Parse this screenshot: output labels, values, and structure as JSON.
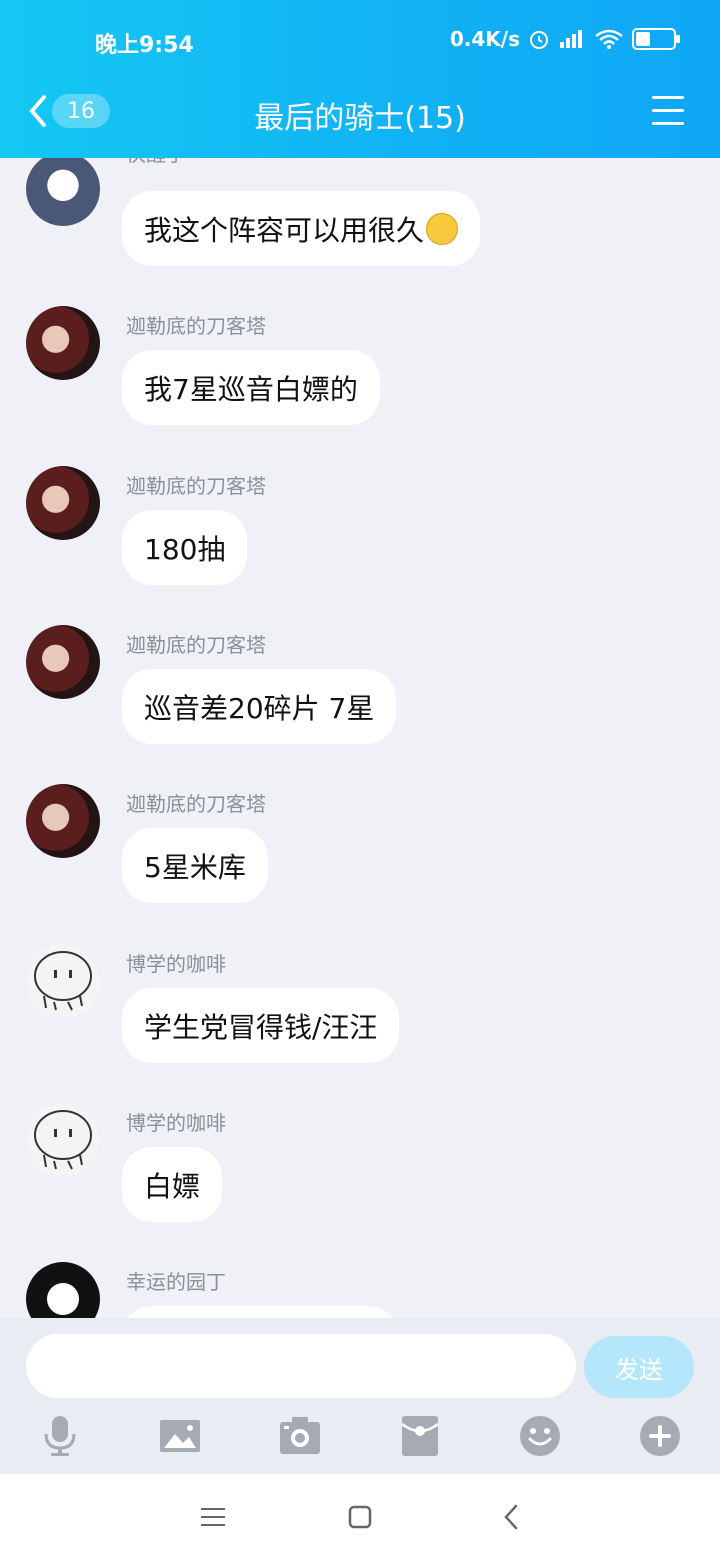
{
  "status_bar": {
    "time": "晚上9:54",
    "net_speed": "0.4K/s"
  },
  "header": {
    "back_count": "16",
    "title": "最后的骑士(15)"
  },
  "messages": [
    {
      "sender": "快醒了",
      "text": "我这个阵容可以用很久",
      "emoji": "smirk-emoji"
    },
    {
      "sender": "迦勒底的刀客塔",
      "text": "我7星巡音白嫖的"
    },
    {
      "sender": "迦勒底的刀客塔",
      "text": "180抽"
    },
    {
      "sender": "迦勒底的刀客塔",
      "text": "巡音差20碎片 7星"
    },
    {
      "sender": "迦勒底的刀客塔",
      "text": "5星米库"
    },
    {
      "sender": "博学的咖啡",
      "text": "学生党冒得钱/汪汪"
    },
    {
      "sender": "博学的咖啡",
      "text": "白嫖"
    },
    {
      "sender": "幸运的园丁",
      "text": ""
    }
  ],
  "input": {
    "value": "",
    "send_label": "发送"
  },
  "toolbar_icons": [
    "microphone-icon",
    "image-icon",
    "camera-icon",
    "red-packet-icon",
    "emoji-icon",
    "plus-icon"
  ],
  "colors": {
    "header": "#11b1f5",
    "chat_bg": "#f0f1f6",
    "send_disabled": "#b4e7fb",
    "icon": "#a5aab5"
  }
}
